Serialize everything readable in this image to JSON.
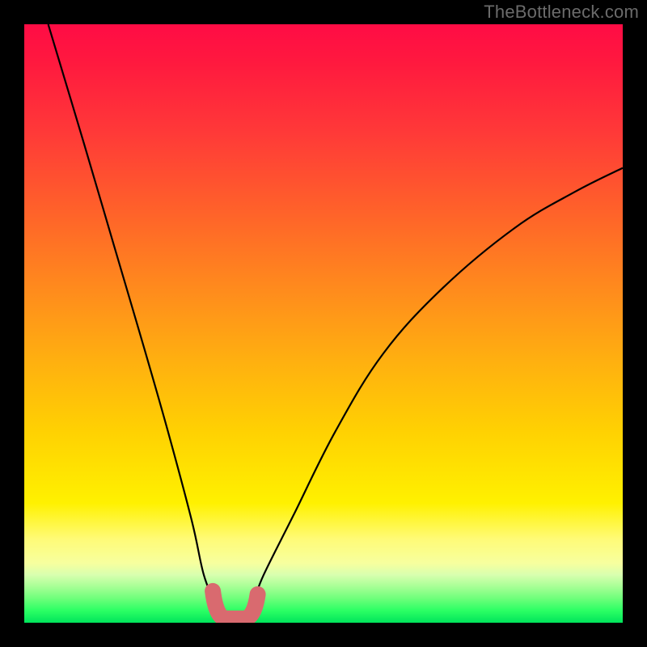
{
  "watermark": "TheBottleneck.com",
  "chart_data": {
    "type": "line",
    "title": "",
    "xlabel": "",
    "ylabel": "",
    "xlim": [
      0,
      100
    ],
    "ylim": [
      0,
      100
    ],
    "series": [
      {
        "name": "bottleneck-curve",
        "x": [
          4,
          10,
          15,
          20,
          24,
          28,
          30,
          32,
          33,
          34,
          36,
          38,
          40,
          45,
          52,
          60,
          70,
          82,
          92,
          100
        ],
        "values": [
          100,
          80,
          63,
          46,
          32,
          17,
          8,
          3,
          1,
          1,
          1,
          3,
          8,
          18,
          32,
          45,
          56,
          66,
          72,
          76
        ]
      }
    ],
    "annotations": [
      {
        "name": "trough-marker",
        "x_range": [
          31.5,
          39
        ],
        "y": 1.5,
        "style": "thick-soft-red"
      }
    ],
    "gradient_stops": [
      {
        "pos": 0.0,
        "color": "#ff0c45"
      },
      {
        "pos": 0.3,
        "color": "#ff6e24"
      },
      {
        "pos": 0.6,
        "color": "#ffc408"
      },
      {
        "pos": 0.85,
        "color": "#fff85e"
      },
      {
        "pos": 0.95,
        "color": "#8fff88"
      },
      {
        "pos": 1.0,
        "color": "#00e45b"
      }
    ]
  }
}
